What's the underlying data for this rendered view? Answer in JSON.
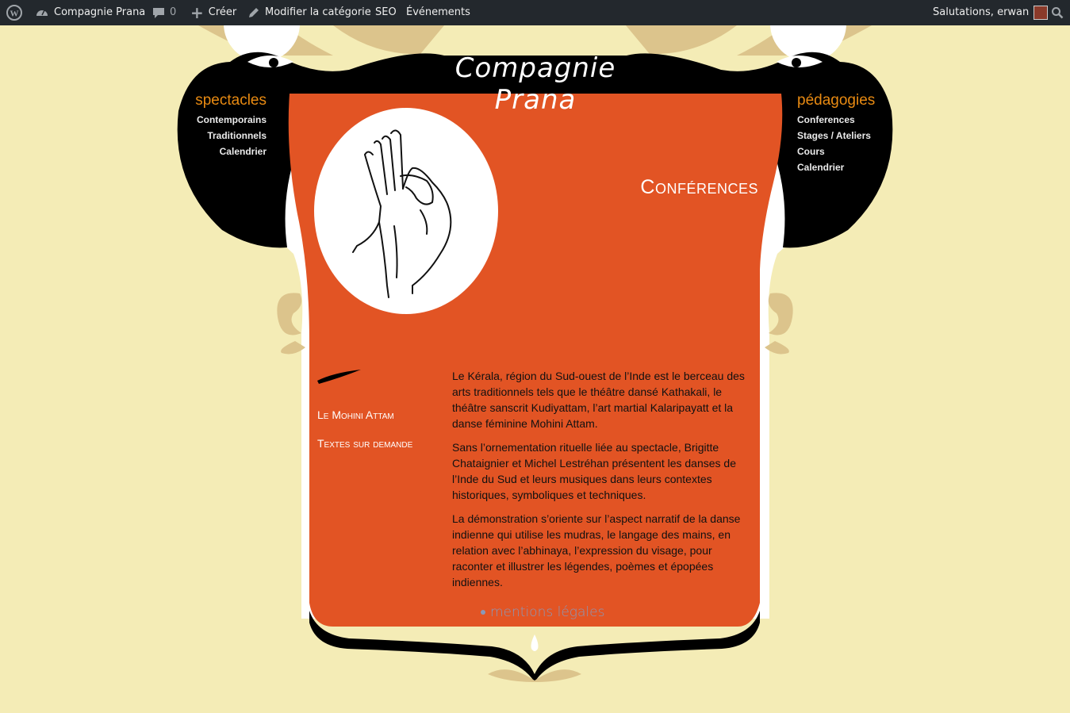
{
  "adminbar": {
    "site_name": "Compagnie Prana",
    "comments_count": "0",
    "create_label": "Créer",
    "edit_category_label": "Modifier la catégorie",
    "seo_label": "SEO",
    "events_label": "Événements",
    "greeting": "Salutations, erwan"
  },
  "site": {
    "logo_text": "Compagnie Prana"
  },
  "nav_left": {
    "heading": "spectacles",
    "items": [
      "Contemporains",
      "Traditionnels",
      "Calendrier"
    ]
  },
  "nav_right": {
    "heading": "pédagogies",
    "items": [
      "Conferences",
      "Stages / Ateliers",
      "Cours",
      "Calendrier"
    ]
  },
  "page": {
    "title": "Conférences",
    "side_links": [
      "Le Mohini Attam",
      "Textes sur demande"
    ],
    "paragraphs": [
      "Le Kérala, région du Sud-ouest de l’Inde est le berceau des arts traditionnels tels que le théâtre dansé Kathakali, le théâtre sanscrit Kudiyattam, l’art martial Kalaripayatt et la danse féminine Mohini Attam.",
      "Sans l’ornementation rituelle liée au spectacle, Brigitte Chataignier et Michel Lestréhan présentent les danses de l’Inde du Sud et leurs musiques dans leurs contextes historiques, symboliques et techniques.",
      "La démonstration s’oriente sur l’aspect narratif de la danse indienne qui utilise les mudras, le langage des mains, en relation avec l’abhinaya, l’expression du visage, pour raconter et illustrer les légendes, poèmes et épopées indiennes."
    ],
    "footer_link": "mentions légales"
  },
  "colors": {
    "background": "#f4ecb6",
    "content_orange": "#e25424",
    "nav_accent": "#e88a12",
    "black": "#000000",
    "tan": "#dcc48c",
    "adminbar": "#23282d"
  },
  "icons": [
    "wordpress-logo-icon",
    "dashboard-icon",
    "comment-icon",
    "plus-icon",
    "pencil-icon",
    "search-icon",
    "hand-mudra-illustration"
  ]
}
